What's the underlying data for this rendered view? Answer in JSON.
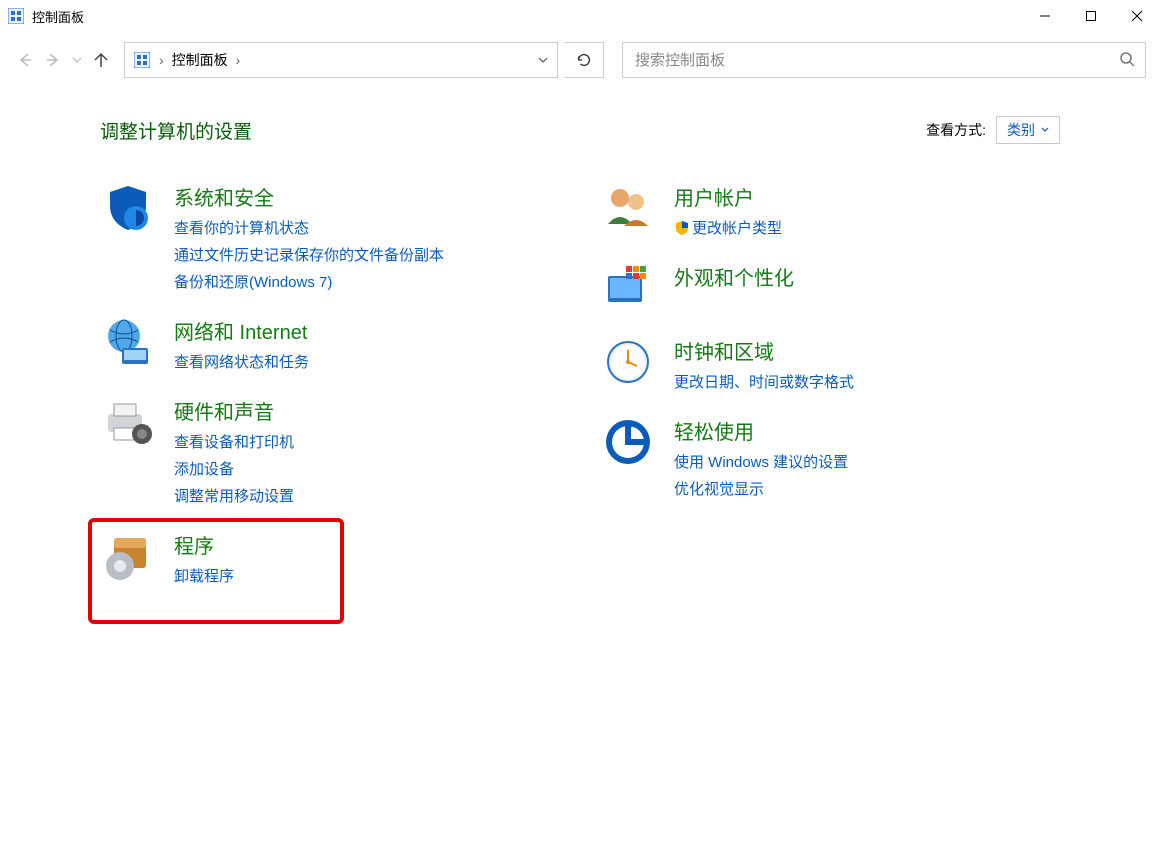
{
  "window": {
    "title": "控制面板"
  },
  "address": {
    "root": "控制面板"
  },
  "search": {
    "placeholder": "搜索控制面板"
  },
  "header": {
    "page_title": "调整计算机的设置",
    "view_by_label": "查看方式:",
    "view_by_value": "类别"
  },
  "left": [
    {
      "title": "系统和安全",
      "links": [
        "查看你的计算机状态",
        "通过文件历史记录保存你的文件备份副本",
        "备份和还原(Windows 7)"
      ]
    },
    {
      "title": "网络和 Internet",
      "links": [
        "查看网络状态和任务"
      ]
    },
    {
      "title": "硬件和声音",
      "links": [
        "查看设备和打印机",
        "添加设备",
        "调整常用移动设置"
      ]
    },
    {
      "title": "程序",
      "links": [
        "卸载程序"
      ]
    }
  ],
  "right": [
    {
      "title": "用户帐户",
      "links": [
        "更改帐户类型"
      ],
      "shield_on": [
        0
      ]
    },
    {
      "title": "外观和个性化",
      "links": []
    },
    {
      "title": "时钟和区域",
      "links": [
        "更改日期、时间或数字格式"
      ]
    },
    {
      "title": "轻松使用",
      "links": [
        "使用 Windows 建议的设置",
        "优化视觉显示"
      ]
    }
  ]
}
